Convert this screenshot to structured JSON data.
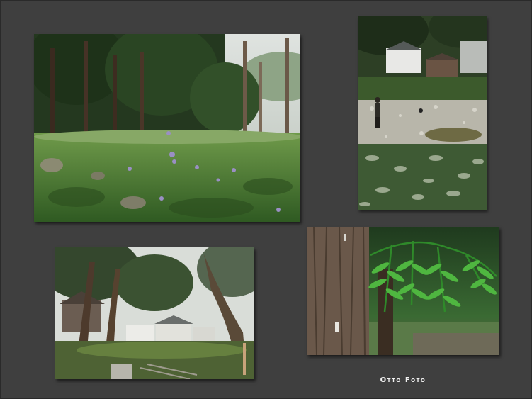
{
  "caption": "Otto Foto",
  "photos": [
    {
      "subject": "forest-meadow-with-flowers"
    },
    {
      "subject": "village-riverbed-with-person"
    },
    {
      "subject": "trees-with-village-houses"
    },
    {
      "subject": "tree-trunk-with-evergreen-branch"
    }
  ],
  "colors": {
    "background": "#3f3f3f",
    "caption": "#f2f2f2"
  }
}
